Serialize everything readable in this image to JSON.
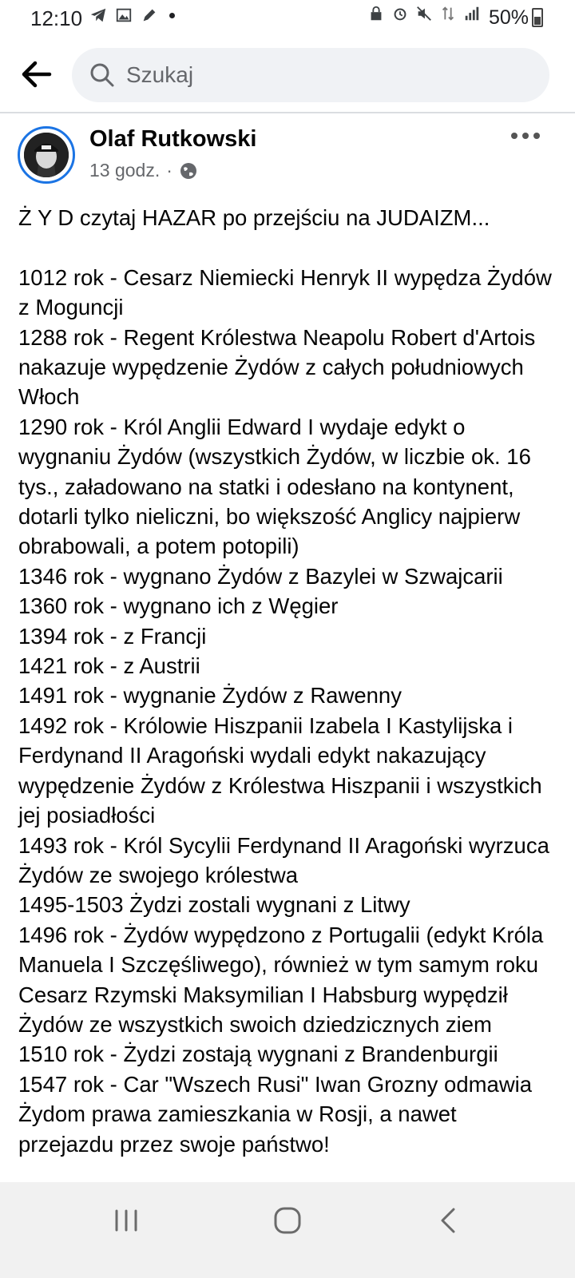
{
  "status_bar": {
    "time": "12:10",
    "battery": "50%"
  },
  "search": {
    "placeholder": "Szukaj"
  },
  "post": {
    "author": "Olaf Rutkowski",
    "time_ago": "13 godz.",
    "separator": "·",
    "intro": "Ż Y D czytaj HAZAR po przejściu na JUDAIZM...",
    "lines": [
      "1012 rok - Cesarz Niemiecki Henryk II wypędza Żydów z Moguncji",
      "1288 rok - Regent Królestwa Neapolu Robert d'Artois nakazuje wypędzenie Żydów z całych południowych Włoch",
      "1290 rok - Król Anglii Edward I wydaje edykt o wygnaniu Żydów (wszystkich Żydów, w liczbie ok. 16 tys., załadowano na statki i odesłano na kontynent, dotarli tylko nieliczni, bo większość Anglicy najpierw obrabowali, a potem potopili)",
      "1346 rok - wygnano Żydów z Bazylei w Szwajcarii",
      "1360 rok - wygnano ich z Węgier",
      "1394 rok - z Francji",
      "1421 rok - z Austrii",
      "1491 rok - wygnanie Żydów z Rawenny",
      "1492 rok - Królowie Hiszpanii Izabela I Kastylijska i Ferdynand II Aragoński wydali edykt nakazujący wypędzenie Żydów z Królestwa Hiszpanii i wszystkich jej posiadłości",
      "1493 rok - Król Sycylii Ferdynand II Aragoński wyrzuca Żydów ze swojego królestwa",
      "1495-1503 Żydzi zostali wygnani z Litwy",
      "1496 rok - Żydów wypędzono z Portugalii (edykt Króla Manuela I Szczęśliwego), również w tym samym roku Cesarz Rzymski Maksymilian I Habsburg wypędził Żydów ze wszystkich swoich dziedzicznych ziem",
      "1510 rok - Żydzi zostają wygnani z Brandenburgii",
      "1547 rok - Car \"Wszech Rusi\" Iwan Grozny odmawia Żydom prawa zamieszkania w Rosji, a nawet przejazdu przez swoje państwo!"
    ]
  },
  "icons": {
    "back": "back-arrow-icon",
    "search": "search-icon",
    "globe": "globe-icon",
    "more": "more-icon"
  },
  "colors": {
    "accent": "#1b74e4",
    "search_bg": "#f0f2f5",
    "meta_text": "#65676b"
  }
}
